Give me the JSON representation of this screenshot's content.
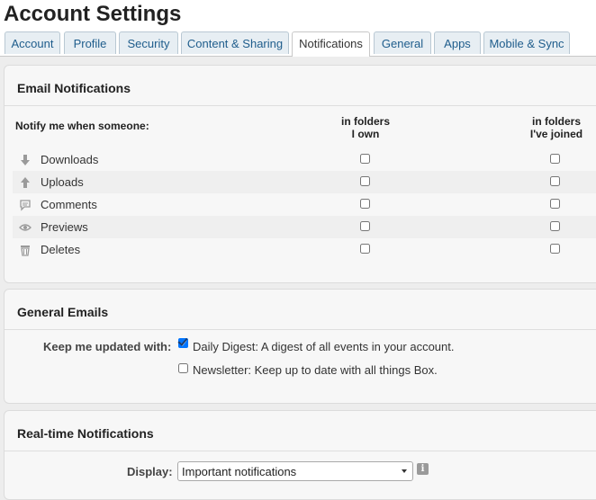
{
  "page": {
    "title": "Account Settings"
  },
  "tabs": [
    {
      "label": "Account",
      "active": false
    },
    {
      "label": "Profile",
      "active": false
    },
    {
      "label": "Security",
      "active": false
    },
    {
      "label": "Content & Sharing",
      "active": false
    },
    {
      "label": "Notifications",
      "active": true
    },
    {
      "label": "General",
      "active": false
    },
    {
      "label": "Apps",
      "active": false
    },
    {
      "label": "Mobile & Sync",
      "active": false
    }
  ],
  "email_notifications": {
    "title": "Email Notifications",
    "notify_label": "Notify me when someone:",
    "col_own": [
      "in folders",
      "I own"
    ],
    "col_joined": [
      "in folders",
      "I've joined"
    ],
    "rows": [
      {
        "label": "Downloads",
        "icon": "download-arrow-icon",
        "own": false,
        "joined": false
      },
      {
        "label": "Uploads",
        "icon": "upload-arrow-icon",
        "own": false,
        "joined": false
      },
      {
        "label": "Comments",
        "icon": "comment-icon",
        "own": false,
        "joined": false
      },
      {
        "label": "Previews",
        "icon": "eye-icon",
        "own": false,
        "joined": false
      },
      {
        "label": "Deletes",
        "icon": "trash-icon",
        "own": false,
        "joined": false
      }
    ]
  },
  "general_emails": {
    "title": "General Emails",
    "keep_label": "Keep me updated with:",
    "options": [
      {
        "label": "Daily Digest: A digest of all events in your account.",
        "checked": true
      },
      {
        "label": "Newsletter: Keep up to date with all things Box.",
        "checked": false
      }
    ]
  },
  "realtime": {
    "title": "Real-time Notifications",
    "display_label": "Display:",
    "display_value": "Important notifications",
    "info_icon": "info-icon"
  },
  "colors": {
    "tab_text": "#1f5d8c",
    "tab_bg": "#e7eef3",
    "panel_bg": "#f7f7f7",
    "checkbox_check": "#1c3d6e"
  }
}
